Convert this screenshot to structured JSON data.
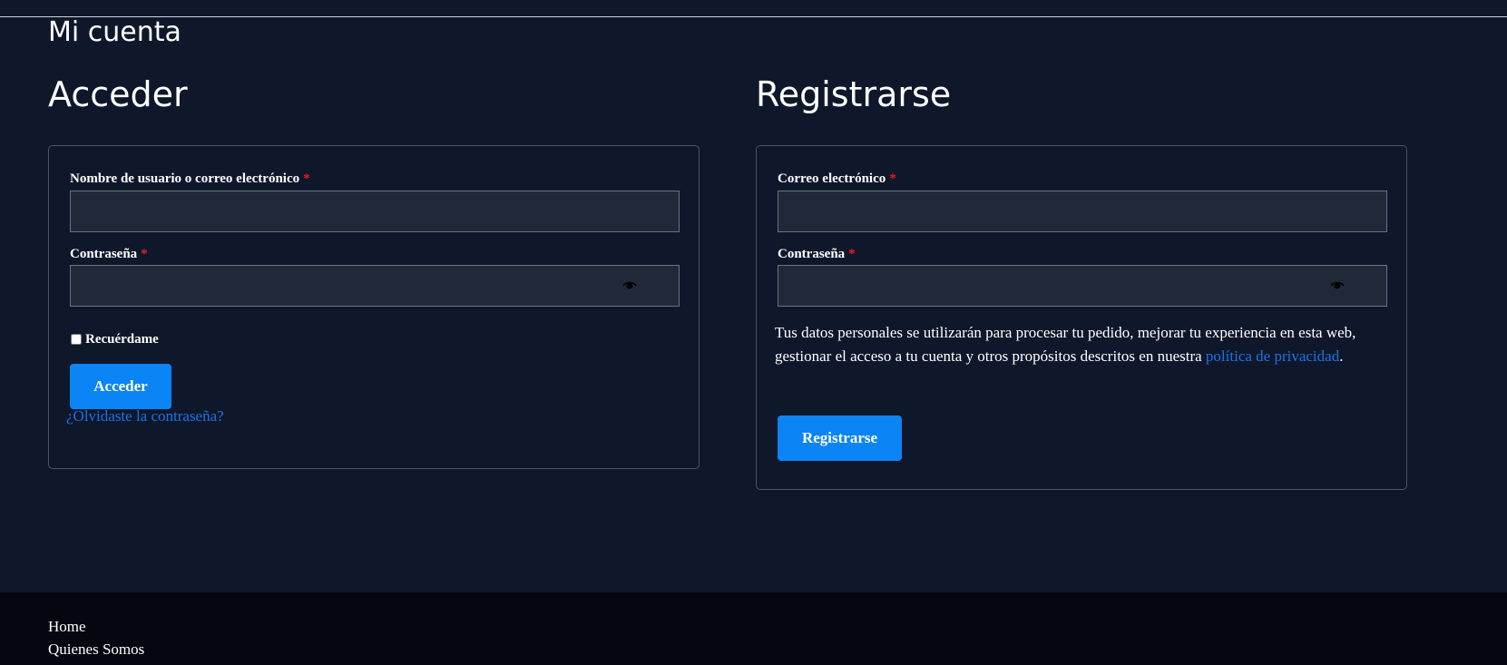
{
  "page": {
    "title": "Mi cuenta"
  },
  "login": {
    "heading": "Acceder",
    "username_label": "Nombre de usuario o correo electrónico",
    "username_value": "",
    "password_label": "Contraseña",
    "password_value": "",
    "required_marker": "*",
    "remember_label": "Recuérdame",
    "remember_checked": false,
    "submit_label": "Acceder",
    "forgot_link": "¿Olvidaste la contraseña?"
  },
  "register": {
    "heading": "Registrarse",
    "email_label": "Correo electrónico",
    "email_value": "",
    "password_label": "Contraseña",
    "password_value": "",
    "required_marker": "*",
    "privacy_text_before": "Tus datos personales se utilizarán para procesar tu pedido, mejorar tu experiencia en esta web, gestionar el acceso a tu cuenta y otros propósitos descritos en nuestra ",
    "privacy_link": "política de privacidad",
    "privacy_text_after": ".",
    "submit_label": "Registrarse"
  },
  "footer": {
    "links": [
      "Home",
      "Quienes Somos"
    ]
  },
  "icons": {
    "password_toggle": "eye-icon"
  },
  "colors": {
    "background": "#0f172a",
    "input_background": "#1f2937",
    "primary_button": "#0b84f5",
    "link": "#1a73e8",
    "required": "#ef1c1c",
    "footer_background": "#05060f"
  }
}
